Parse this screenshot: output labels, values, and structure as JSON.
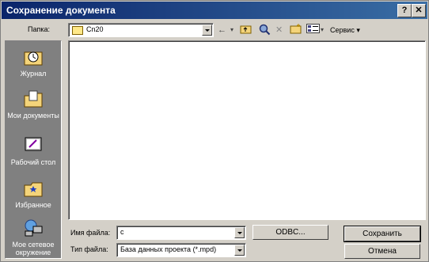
{
  "window": {
    "title": "Сохранение документа"
  },
  "titlebar_buttons": {
    "help": "?",
    "close": "✕"
  },
  "toolbar": {
    "folder_label": "Папка:",
    "folder_value": "Cn20",
    "service_label": "Сервис"
  },
  "places": [
    {
      "label": "Журнал"
    },
    {
      "label": "Мои документы"
    },
    {
      "label": "Рабочий стол"
    },
    {
      "label": "Избранное"
    },
    {
      "label": "Мое сетевое окружение"
    }
  ],
  "form": {
    "filename_label": "Имя файла:",
    "filename_value": "c",
    "filetype_label": "Тип файла:",
    "filetype_value": "База данных проекта (*.mpd)"
  },
  "buttons": {
    "odbc": "ODBC...",
    "save": "Сохранить",
    "cancel": "Отмена"
  }
}
